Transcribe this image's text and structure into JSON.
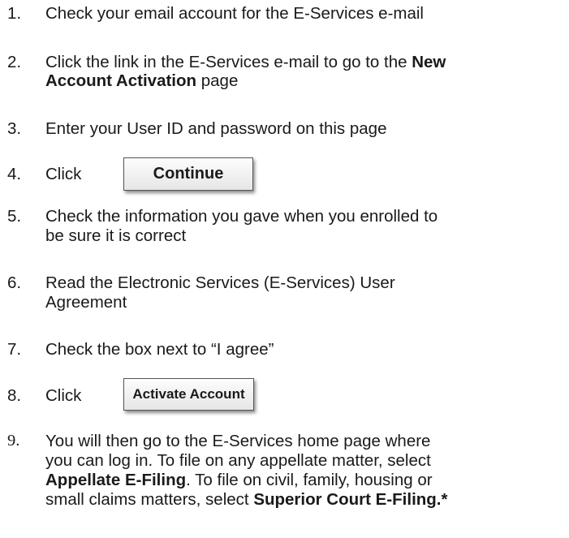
{
  "steps": [
    {
      "number": "1.",
      "lines": [
        "Check your email account for the E-Services e-mail"
      ]
    },
    {
      "number": "2.",
      "line1_pre": "Click the link in the E-Services e-mail to go to the ",
      "line1_bold": "New",
      "line2_bold": "Account Activation",
      "line2_post": " page"
    },
    {
      "number": "3.",
      "lines": [
        "Enter your User ID and password on this page"
      ]
    },
    {
      "number": "4.",
      "text": "Click",
      "button_label": "Continue"
    },
    {
      "number": "5.",
      "lines": [
        "Check the information you gave when you enrolled to",
        "be sure it is correct"
      ]
    },
    {
      "number": "6.",
      "lines": [
        "Read the Electronic Services (E-Services) User",
        "Agreement"
      ]
    },
    {
      "number": "7.",
      "lines": [
        "Check the box next to “I agree”"
      ]
    },
    {
      "number": "8.",
      "text": "Click",
      "button_label": "Activate Account"
    },
    {
      "number": "9.",
      "line1": "You will then go to the E-Services home page where",
      "line2": "you can log in.  To file on any appellate matter, select",
      "line3_bold": "Appellate E-Filing",
      "line3_post": ".  To file on civil, family, housing or",
      "line4_pre": "small claims matters, select ",
      "line4_bold": "Superior Court E-Filing.*"
    }
  ]
}
